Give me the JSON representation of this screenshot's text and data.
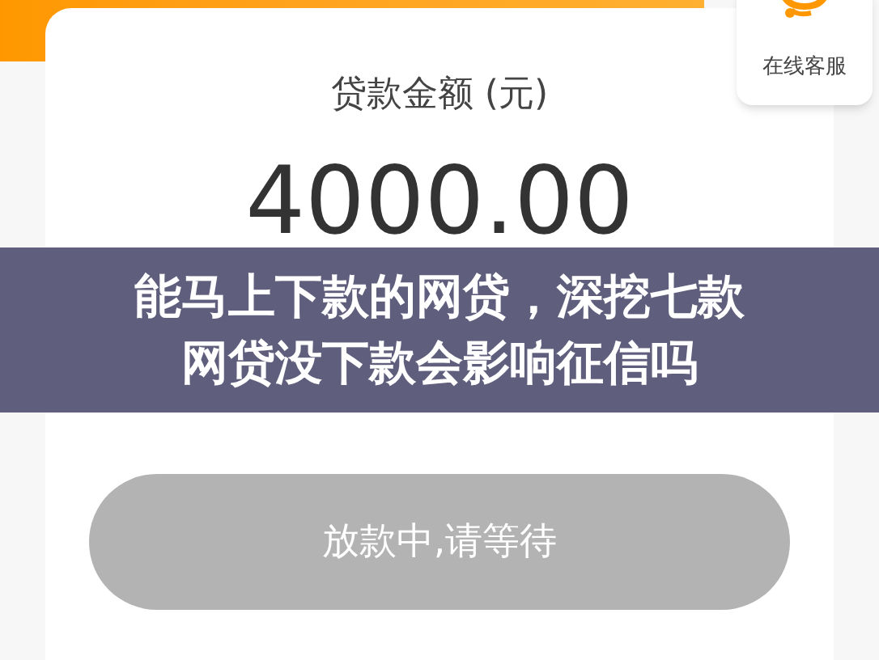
{
  "loan_card": {
    "label": "贷款金额 (元)",
    "amount": "4000.00"
  },
  "support_widget": {
    "label": "在线客服"
  },
  "status_button": {
    "label": "放款中,请等待",
    "disabled": true
  },
  "title_banner": {
    "lines": [
      "能马上下款的网贷，深挖七款",
      "网贷没下款会影响征信吗"
    ]
  }
}
